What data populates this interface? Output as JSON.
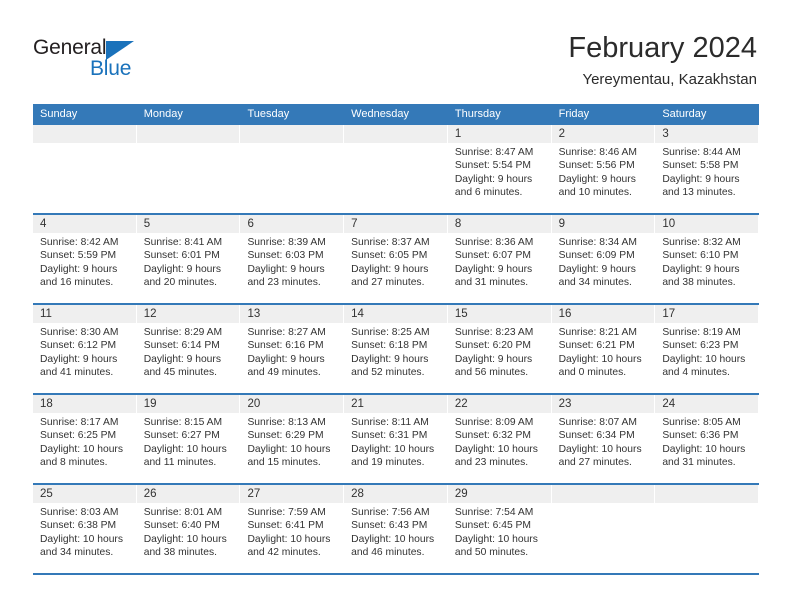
{
  "brand": {
    "name_top": "General",
    "name_bottom": "Blue",
    "accent_color": "#1a72bb",
    "triangle_icon": "logo-triangle-icon"
  },
  "header": {
    "title": "February 2024",
    "subtitle": "Yereymentau, Kazakhstan"
  },
  "calendar": {
    "header_bg": "#3479b8",
    "day_header_bg": "#efefef",
    "weekdays": [
      "Sunday",
      "Monday",
      "Tuesday",
      "Wednesday",
      "Thursday",
      "Friday",
      "Saturday"
    ],
    "weeks": [
      [
        {
          "date": "",
          "sunrise": "",
          "sunset": "",
          "daylight1": "",
          "daylight2": ""
        },
        {
          "date": "",
          "sunrise": "",
          "sunset": "",
          "daylight1": "",
          "daylight2": ""
        },
        {
          "date": "",
          "sunrise": "",
          "sunset": "",
          "daylight1": "",
          "daylight2": ""
        },
        {
          "date": "",
          "sunrise": "",
          "sunset": "",
          "daylight1": "",
          "daylight2": ""
        },
        {
          "date": "1",
          "sunrise": "Sunrise: 8:47 AM",
          "sunset": "Sunset: 5:54 PM",
          "daylight1": "Daylight: 9 hours",
          "daylight2": "and 6 minutes."
        },
        {
          "date": "2",
          "sunrise": "Sunrise: 8:46 AM",
          "sunset": "Sunset: 5:56 PM",
          "daylight1": "Daylight: 9 hours",
          "daylight2": "and 10 minutes."
        },
        {
          "date": "3",
          "sunrise": "Sunrise: 8:44 AM",
          "sunset": "Sunset: 5:58 PM",
          "daylight1": "Daylight: 9 hours",
          "daylight2": "and 13 minutes."
        }
      ],
      [
        {
          "date": "4",
          "sunrise": "Sunrise: 8:42 AM",
          "sunset": "Sunset: 5:59 PM",
          "daylight1": "Daylight: 9 hours",
          "daylight2": "and 16 minutes."
        },
        {
          "date": "5",
          "sunrise": "Sunrise: 8:41 AM",
          "sunset": "Sunset: 6:01 PM",
          "daylight1": "Daylight: 9 hours",
          "daylight2": "and 20 minutes."
        },
        {
          "date": "6",
          "sunrise": "Sunrise: 8:39 AM",
          "sunset": "Sunset: 6:03 PM",
          "daylight1": "Daylight: 9 hours",
          "daylight2": "and 23 minutes."
        },
        {
          "date": "7",
          "sunrise": "Sunrise: 8:37 AM",
          "sunset": "Sunset: 6:05 PM",
          "daylight1": "Daylight: 9 hours",
          "daylight2": "and 27 minutes."
        },
        {
          "date": "8",
          "sunrise": "Sunrise: 8:36 AM",
          "sunset": "Sunset: 6:07 PM",
          "daylight1": "Daylight: 9 hours",
          "daylight2": "and 31 minutes."
        },
        {
          "date": "9",
          "sunrise": "Sunrise: 8:34 AM",
          "sunset": "Sunset: 6:09 PM",
          "daylight1": "Daylight: 9 hours",
          "daylight2": "and 34 minutes."
        },
        {
          "date": "10",
          "sunrise": "Sunrise: 8:32 AM",
          "sunset": "Sunset: 6:10 PM",
          "daylight1": "Daylight: 9 hours",
          "daylight2": "and 38 minutes."
        }
      ],
      [
        {
          "date": "11",
          "sunrise": "Sunrise: 8:30 AM",
          "sunset": "Sunset: 6:12 PM",
          "daylight1": "Daylight: 9 hours",
          "daylight2": "and 41 minutes."
        },
        {
          "date": "12",
          "sunrise": "Sunrise: 8:29 AM",
          "sunset": "Sunset: 6:14 PM",
          "daylight1": "Daylight: 9 hours",
          "daylight2": "and 45 minutes."
        },
        {
          "date": "13",
          "sunrise": "Sunrise: 8:27 AM",
          "sunset": "Sunset: 6:16 PM",
          "daylight1": "Daylight: 9 hours",
          "daylight2": "and 49 minutes."
        },
        {
          "date": "14",
          "sunrise": "Sunrise: 8:25 AM",
          "sunset": "Sunset: 6:18 PM",
          "daylight1": "Daylight: 9 hours",
          "daylight2": "and 52 minutes."
        },
        {
          "date": "15",
          "sunrise": "Sunrise: 8:23 AM",
          "sunset": "Sunset: 6:20 PM",
          "daylight1": "Daylight: 9 hours",
          "daylight2": "and 56 minutes."
        },
        {
          "date": "16",
          "sunrise": "Sunrise: 8:21 AM",
          "sunset": "Sunset: 6:21 PM",
          "daylight1": "Daylight: 10 hours",
          "daylight2": "and 0 minutes."
        },
        {
          "date": "17",
          "sunrise": "Sunrise: 8:19 AM",
          "sunset": "Sunset: 6:23 PM",
          "daylight1": "Daylight: 10 hours",
          "daylight2": "and 4 minutes."
        }
      ],
      [
        {
          "date": "18",
          "sunrise": "Sunrise: 8:17 AM",
          "sunset": "Sunset: 6:25 PM",
          "daylight1": "Daylight: 10 hours",
          "daylight2": "and 8 minutes."
        },
        {
          "date": "19",
          "sunrise": "Sunrise: 8:15 AM",
          "sunset": "Sunset: 6:27 PM",
          "daylight1": "Daylight: 10 hours",
          "daylight2": "and 11 minutes."
        },
        {
          "date": "20",
          "sunrise": "Sunrise: 8:13 AM",
          "sunset": "Sunset: 6:29 PM",
          "daylight1": "Daylight: 10 hours",
          "daylight2": "and 15 minutes."
        },
        {
          "date": "21",
          "sunrise": "Sunrise: 8:11 AM",
          "sunset": "Sunset: 6:31 PM",
          "daylight1": "Daylight: 10 hours",
          "daylight2": "and 19 minutes."
        },
        {
          "date": "22",
          "sunrise": "Sunrise: 8:09 AM",
          "sunset": "Sunset: 6:32 PM",
          "daylight1": "Daylight: 10 hours",
          "daylight2": "and 23 minutes."
        },
        {
          "date": "23",
          "sunrise": "Sunrise: 8:07 AM",
          "sunset": "Sunset: 6:34 PM",
          "daylight1": "Daylight: 10 hours",
          "daylight2": "and 27 minutes."
        },
        {
          "date": "24",
          "sunrise": "Sunrise: 8:05 AM",
          "sunset": "Sunset: 6:36 PM",
          "daylight1": "Daylight: 10 hours",
          "daylight2": "and 31 minutes."
        }
      ],
      [
        {
          "date": "25",
          "sunrise": "Sunrise: 8:03 AM",
          "sunset": "Sunset: 6:38 PM",
          "daylight1": "Daylight: 10 hours",
          "daylight2": "and 34 minutes."
        },
        {
          "date": "26",
          "sunrise": "Sunrise: 8:01 AM",
          "sunset": "Sunset: 6:40 PM",
          "daylight1": "Daylight: 10 hours",
          "daylight2": "and 38 minutes."
        },
        {
          "date": "27",
          "sunrise": "Sunrise: 7:59 AM",
          "sunset": "Sunset: 6:41 PM",
          "daylight1": "Daylight: 10 hours",
          "daylight2": "and 42 minutes."
        },
        {
          "date": "28",
          "sunrise": "Sunrise: 7:56 AM",
          "sunset": "Sunset: 6:43 PM",
          "daylight1": "Daylight: 10 hours",
          "daylight2": "and 46 minutes."
        },
        {
          "date": "29",
          "sunrise": "Sunrise: 7:54 AM",
          "sunset": "Sunset: 6:45 PM",
          "daylight1": "Daylight: 10 hours",
          "daylight2": "and 50 minutes."
        },
        {
          "date": "",
          "sunrise": "",
          "sunset": "",
          "daylight1": "",
          "daylight2": ""
        },
        {
          "date": "",
          "sunrise": "",
          "sunset": "",
          "daylight1": "",
          "daylight2": ""
        }
      ]
    ]
  }
}
